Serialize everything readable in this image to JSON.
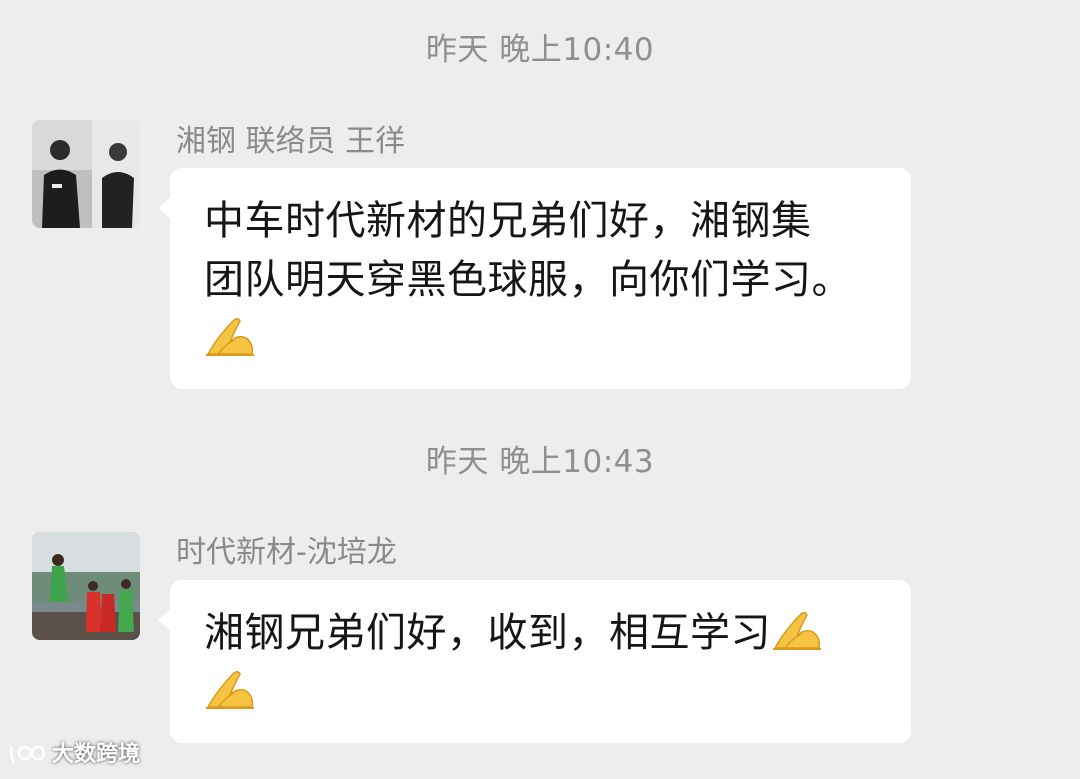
{
  "chat": {
    "messages": [
      {
        "timestamp": "昨天 晚上10:40",
        "sender": "湘钢 联络员 王徉",
        "text_lines": [
          "中车时代新材的兄弟们好，湘钢集",
          "团队明天穿黑色球服，向你们学习。"
        ],
        "trailing_emoji": "folded-hands-icon"
      },
      {
        "timestamp": "昨天 晚上10:43",
        "sender": "时代新材-沈培龙",
        "text_lines": [
          "湘钢兄弟们好，收到，相互学习"
        ],
        "trailing_emoji": "folded-hands-icon"
      }
    ]
  },
  "watermark": {
    "text": "大数跨境"
  },
  "colors": {
    "background": "#ededed",
    "bubble": "#ffffff",
    "meta_text": "#8f8f8f",
    "body_text": "#161616",
    "emoji_fill": "#f5c542"
  }
}
